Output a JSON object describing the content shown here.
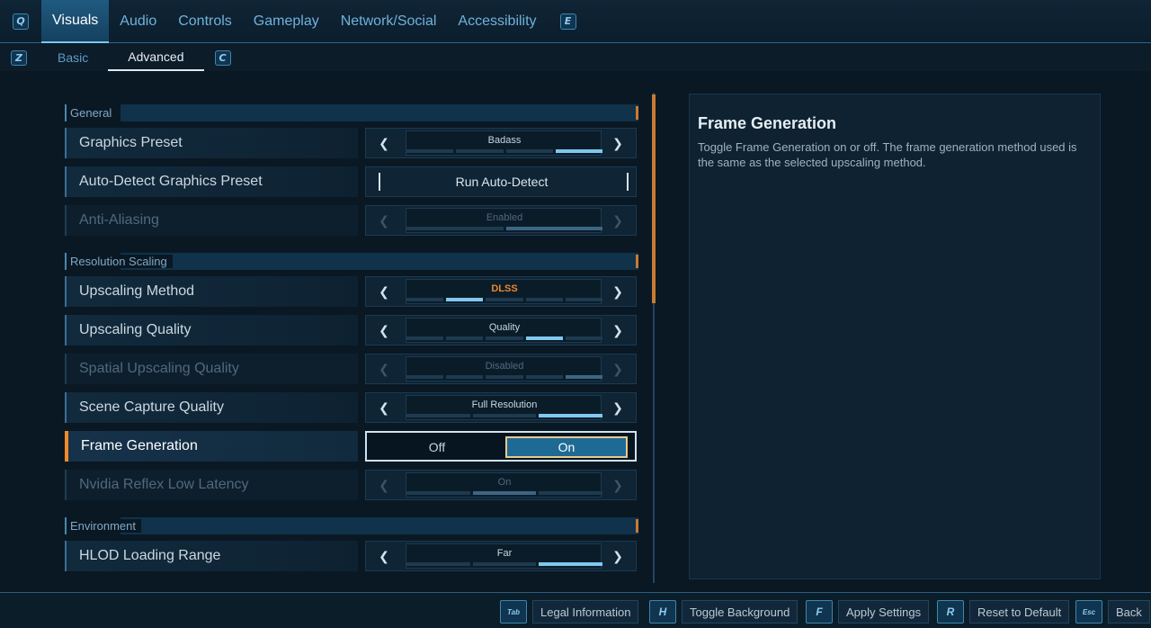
{
  "top_nav": {
    "left_key": "Q",
    "right_key": "E",
    "tabs": [
      "Visuals",
      "Audio",
      "Controls",
      "Gameplay",
      "Network/Social",
      "Accessibility"
    ],
    "active_index": 0
  },
  "sub_nav": {
    "left_key": "Z",
    "right_key": "C",
    "tabs": [
      "Basic",
      "Advanced"
    ],
    "active_index": 1
  },
  "sections": {
    "general": "General",
    "resolution_scaling": "Resolution Scaling",
    "environment": "Environment"
  },
  "settings": {
    "graphics_preset": {
      "label": "Graphics Preset",
      "value": "Badass"
    },
    "auto_detect": {
      "label": "Auto-Detect Graphics Preset",
      "button": "Run Auto-Detect"
    },
    "anti_aliasing": {
      "label": "Anti-Aliasing",
      "value": "Enabled"
    },
    "upscaling_method": {
      "label": "Upscaling Method",
      "value": "DLSS"
    },
    "upscaling_quality": {
      "label": "Upscaling Quality",
      "value": "Quality"
    },
    "spatial_upscaling_quality": {
      "label": "Spatial Upscaling Quality",
      "value": "Disabled"
    },
    "scene_capture_quality": {
      "label": "Scene Capture Quality",
      "value": "Full Resolution"
    },
    "frame_generation": {
      "label": "Frame Generation",
      "off": "Off",
      "on": "On"
    },
    "nvidia_reflex": {
      "label": "Nvidia Reflex Low Latency",
      "value": "On"
    },
    "hlod_loading_range": {
      "label": "HLOD Loading Range",
      "value": "Far"
    }
  },
  "description": {
    "title": "Frame Generation",
    "body": "Toggle Frame Generation on or off. The frame generation method used is the same as the selected upscaling method."
  },
  "bottom_hints": [
    {
      "key": "Tab",
      "label": "Legal Information"
    },
    {
      "key": "H",
      "label": "Toggle Background"
    },
    {
      "key": "F",
      "label": "Apply Settings"
    },
    {
      "key": "R",
      "label": "Reset to Default"
    },
    {
      "key": "Esc",
      "label": "Back"
    }
  ],
  "colors": {
    "accent_blue": "#7fc8f0",
    "accent_orange": "#e8862f",
    "background": "#0a1824"
  }
}
